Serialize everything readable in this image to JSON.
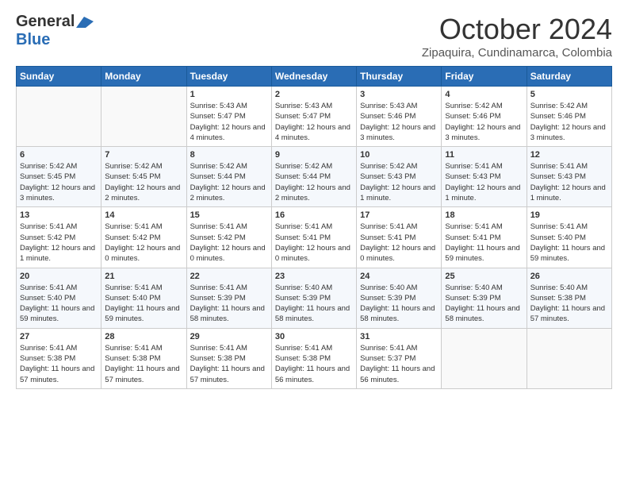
{
  "header": {
    "logo_line1": "General",
    "logo_line2": "Blue",
    "month": "October 2024",
    "location": "Zipaquira, Cundinamarca, Colombia"
  },
  "days_of_week": [
    "Sunday",
    "Monday",
    "Tuesday",
    "Wednesday",
    "Thursday",
    "Friday",
    "Saturday"
  ],
  "weeks": [
    [
      {
        "num": "",
        "info": ""
      },
      {
        "num": "",
        "info": ""
      },
      {
        "num": "1",
        "info": "Sunrise: 5:43 AM\nSunset: 5:47 PM\nDaylight: 12 hours and 4 minutes."
      },
      {
        "num": "2",
        "info": "Sunrise: 5:43 AM\nSunset: 5:47 PM\nDaylight: 12 hours and 4 minutes."
      },
      {
        "num": "3",
        "info": "Sunrise: 5:43 AM\nSunset: 5:46 PM\nDaylight: 12 hours and 3 minutes."
      },
      {
        "num": "4",
        "info": "Sunrise: 5:42 AM\nSunset: 5:46 PM\nDaylight: 12 hours and 3 minutes."
      },
      {
        "num": "5",
        "info": "Sunrise: 5:42 AM\nSunset: 5:46 PM\nDaylight: 12 hours and 3 minutes."
      }
    ],
    [
      {
        "num": "6",
        "info": "Sunrise: 5:42 AM\nSunset: 5:45 PM\nDaylight: 12 hours and 3 minutes."
      },
      {
        "num": "7",
        "info": "Sunrise: 5:42 AM\nSunset: 5:45 PM\nDaylight: 12 hours and 2 minutes."
      },
      {
        "num": "8",
        "info": "Sunrise: 5:42 AM\nSunset: 5:44 PM\nDaylight: 12 hours and 2 minutes."
      },
      {
        "num": "9",
        "info": "Sunrise: 5:42 AM\nSunset: 5:44 PM\nDaylight: 12 hours and 2 minutes."
      },
      {
        "num": "10",
        "info": "Sunrise: 5:42 AM\nSunset: 5:43 PM\nDaylight: 12 hours and 1 minute."
      },
      {
        "num": "11",
        "info": "Sunrise: 5:41 AM\nSunset: 5:43 PM\nDaylight: 12 hours and 1 minute."
      },
      {
        "num": "12",
        "info": "Sunrise: 5:41 AM\nSunset: 5:43 PM\nDaylight: 12 hours and 1 minute."
      }
    ],
    [
      {
        "num": "13",
        "info": "Sunrise: 5:41 AM\nSunset: 5:42 PM\nDaylight: 12 hours and 1 minute."
      },
      {
        "num": "14",
        "info": "Sunrise: 5:41 AM\nSunset: 5:42 PM\nDaylight: 12 hours and 0 minutes."
      },
      {
        "num": "15",
        "info": "Sunrise: 5:41 AM\nSunset: 5:42 PM\nDaylight: 12 hours and 0 minutes."
      },
      {
        "num": "16",
        "info": "Sunrise: 5:41 AM\nSunset: 5:41 PM\nDaylight: 12 hours and 0 minutes."
      },
      {
        "num": "17",
        "info": "Sunrise: 5:41 AM\nSunset: 5:41 PM\nDaylight: 12 hours and 0 minutes."
      },
      {
        "num": "18",
        "info": "Sunrise: 5:41 AM\nSunset: 5:41 PM\nDaylight: 11 hours and 59 minutes."
      },
      {
        "num": "19",
        "info": "Sunrise: 5:41 AM\nSunset: 5:40 PM\nDaylight: 11 hours and 59 minutes."
      }
    ],
    [
      {
        "num": "20",
        "info": "Sunrise: 5:41 AM\nSunset: 5:40 PM\nDaylight: 11 hours and 59 minutes."
      },
      {
        "num": "21",
        "info": "Sunrise: 5:41 AM\nSunset: 5:40 PM\nDaylight: 11 hours and 59 minutes."
      },
      {
        "num": "22",
        "info": "Sunrise: 5:41 AM\nSunset: 5:39 PM\nDaylight: 11 hours and 58 minutes."
      },
      {
        "num": "23",
        "info": "Sunrise: 5:40 AM\nSunset: 5:39 PM\nDaylight: 11 hours and 58 minutes."
      },
      {
        "num": "24",
        "info": "Sunrise: 5:40 AM\nSunset: 5:39 PM\nDaylight: 11 hours and 58 minutes."
      },
      {
        "num": "25",
        "info": "Sunrise: 5:40 AM\nSunset: 5:39 PM\nDaylight: 11 hours and 58 minutes."
      },
      {
        "num": "26",
        "info": "Sunrise: 5:40 AM\nSunset: 5:38 PM\nDaylight: 11 hours and 57 minutes."
      }
    ],
    [
      {
        "num": "27",
        "info": "Sunrise: 5:41 AM\nSunset: 5:38 PM\nDaylight: 11 hours and 57 minutes."
      },
      {
        "num": "28",
        "info": "Sunrise: 5:41 AM\nSunset: 5:38 PM\nDaylight: 11 hours and 57 minutes."
      },
      {
        "num": "29",
        "info": "Sunrise: 5:41 AM\nSunset: 5:38 PM\nDaylight: 11 hours and 57 minutes."
      },
      {
        "num": "30",
        "info": "Sunrise: 5:41 AM\nSunset: 5:38 PM\nDaylight: 11 hours and 56 minutes."
      },
      {
        "num": "31",
        "info": "Sunrise: 5:41 AM\nSunset: 5:37 PM\nDaylight: 11 hours and 56 minutes."
      },
      {
        "num": "",
        "info": ""
      },
      {
        "num": "",
        "info": ""
      }
    ]
  ]
}
